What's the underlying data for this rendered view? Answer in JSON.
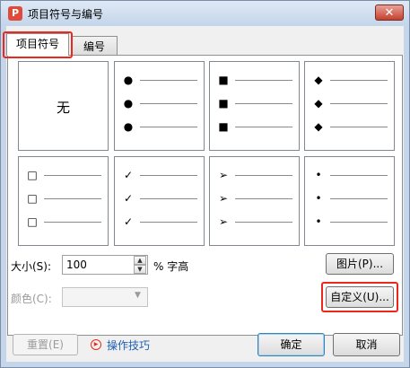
{
  "window": {
    "title": "项目符号与编号",
    "app_icon": "P",
    "close_glyph": "✕"
  },
  "tabs": [
    {
      "label": "项目符号",
      "active": true
    },
    {
      "label": "编号",
      "active": false
    }
  ],
  "bullets": {
    "none_label": "无",
    "styles": [
      {
        "symbol": "●"
      },
      {
        "symbol": "■"
      },
      {
        "symbol": "◆"
      },
      {
        "symbol": "□"
      },
      {
        "symbol": "✓"
      },
      {
        "symbol": "➢"
      },
      {
        "symbol": "•"
      }
    ]
  },
  "size": {
    "label": "大小(S):",
    "value": "100",
    "unit": "% 字高"
  },
  "color": {
    "label": "颜色(C):"
  },
  "buttons": {
    "picture": "图片(P)...",
    "customize": "自定义(U)...",
    "reset": "重置(E)",
    "ok": "确定",
    "cancel": "取消"
  },
  "tips": {
    "label": "操作技巧"
  },
  "colors": {
    "highlight": "#e8291c",
    "link": "#1c5fb3"
  }
}
